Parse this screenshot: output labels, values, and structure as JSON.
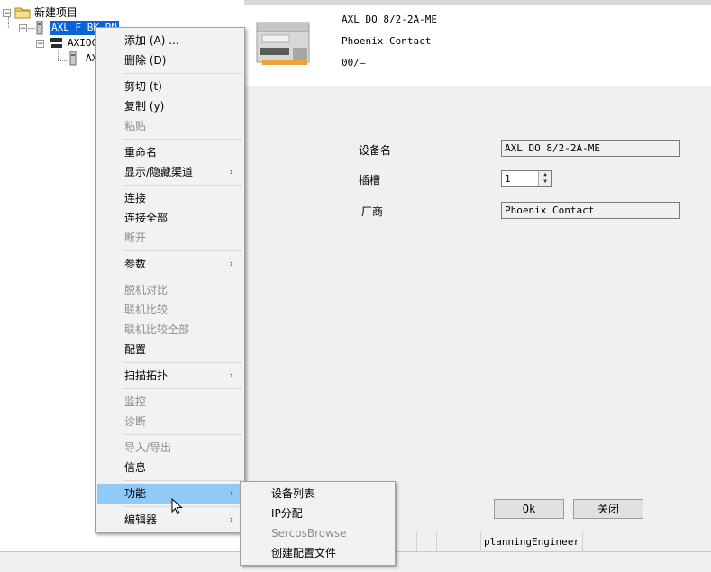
{
  "tree": {
    "root_label": "新建项目",
    "node1_label": "AXL F BK PN",
    "node2_label": "AXIOC",
    "node3_label": "AX"
  },
  "device": {
    "name": "AXL DO 8/2-2A-ME",
    "vendor": "Phoenix Contact",
    "version": "00/—"
  },
  "form": {
    "device_name_label": "设备名",
    "device_name_value": "AXL DO 8/2-2A-ME",
    "slot_label": "插槽",
    "slot_value": "1",
    "vendor_label": "厂商",
    "vendor_value": "Phoenix Contact"
  },
  "buttons": {
    "ok": "Ok",
    "close": "关闭"
  },
  "status": {
    "user": "planningEngineer"
  },
  "context_menu": {
    "items": [
      {
        "label": "添加 (A) ...",
        "enabled": true
      },
      {
        "label": "删除 (D)",
        "enabled": true
      },
      {
        "label": "剪切 (t)",
        "enabled": true
      },
      {
        "label": "复制 (y)",
        "enabled": true
      },
      {
        "label": "粘贴",
        "enabled": false
      },
      {
        "label": "重命名",
        "enabled": true
      },
      {
        "label": "显示/隐藏渠道",
        "enabled": true
      },
      {
        "label": "连接",
        "enabled": true
      },
      {
        "label": "连接全部",
        "enabled": true
      },
      {
        "label": "断开",
        "enabled": false
      },
      {
        "label": "参数",
        "enabled": true
      },
      {
        "label": "脱机对比",
        "enabled": false
      },
      {
        "label": "联机比较",
        "enabled": false
      },
      {
        "label": "联机比较全部",
        "enabled": false
      },
      {
        "label": "配置",
        "enabled": true
      },
      {
        "label": "扫描拓扑",
        "enabled": true
      },
      {
        "label": "监控",
        "enabled": false
      },
      {
        "label": "诊断",
        "enabled": false
      },
      {
        "label": "导入/导出",
        "enabled": false
      },
      {
        "label": "信息",
        "enabled": true
      },
      {
        "label": "功能",
        "enabled": true
      },
      {
        "label": "编辑器",
        "enabled": true
      }
    ]
  },
  "submenu": {
    "items": [
      {
        "label": "设备列表",
        "enabled": true
      },
      {
        "label": "IP分配",
        "enabled": true
      },
      {
        "label": "SercosBrowse",
        "enabled": false
      },
      {
        "label": "创建配置文件",
        "enabled": true
      }
    ]
  },
  "colors": {
    "selection": "#0a64d8",
    "menu_highlight": "#91c9f7",
    "disabled_text": "#8d8d8d"
  }
}
